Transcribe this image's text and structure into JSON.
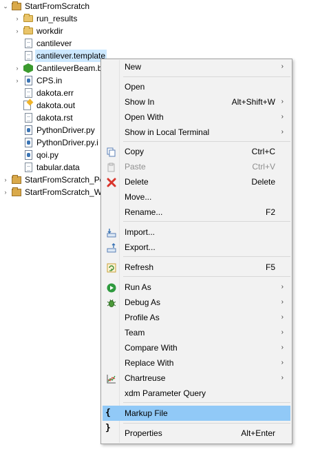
{
  "tree": {
    "items": [
      {
        "label": "StartFromScratch",
        "arrow": "⌄",
        "icon": "project-folder-icon"
      },
      {
        "label": "run_results",
        "arrow": "›",
        "icon": "folder-icon"
      },
      {
        "label": "workdir",
        "arrow": "›",
        "icon": "folder-icon"
      },
      {
        "label": "cantilever",
        "arrow": "",
        "icon": "file-icon"
      },
      {
        "label": "cantilever.template",
        "arrow": "",
        "icon": "file-icon"
      },
      {
        "label": "CantileverBeam.b",
        "arrow": "›",
        "icon": "hex-icon"
      },
      {
        "label": "CPS.in",
        "arrow": "›",
        "icon": "python-file-icon"
      },
      {
        "label": "dakota.err",
        "arrow": "",
        "icon": "file-icon"
      },
      {
        "label": "dakota.out",
        "arrow": "",
        "icon": "output-file-icon"
      },
      {
        "label": "dakota.rst",
        "arrow": "",
        "icon": "file-icon"
      },
      {
        "label": "PythonDriver.py",
        "arrow": "",
        "icon": "python-file-icon"
      },
      {
        "label": "PythonDriver.py.i",
        "arrow": "",
        "icon": "python-file-icon"
      },
      {
        "label": "qoi.py",
        "arrow": "",
        "icon": "python-file-icon"
      },
      {
        "label": "tabular.data",
        "arrow": "",
        "icon": "file-icon"
      },
      {
        "label": "StartFromScratch_Po",
        "arrow": "›",
        "icon": "project-folder-icon"
      },
      {
        "label": "StartFromScratch_W",
        "arrow": "›",
        "icon": "project-folder-icon"
      }
    ]
  },
  "menu": {
    "items": [
      {
        "label": "New",
        "accel": "",
        "submenu": true
      },
      {
        "label": "Open",
        "accel": "",
        "submenu": false
      },
      {
        "label": "Show In",
        "accel": "Alt+Shift+W",
        "submenu": true
      },
      {
        "label": "Open With",
        "accel": "",
        "submenu": true
      },
      {
        "label": "Show in Local Terminal",
        "accel": "",
        "submenu": true
      },
      {
        "label": "Copy",
        "accel": "Ctrl+C",
        "submenu": false
      },
      {
        "label": "Paste",
        "accel": "Ctrl+V",
        "submenu": false,
        "disabled": true
      },
      {
        "label": "Delete",
        "accel": "Delete",
        "submenu": false
      },
      {
        "label": "Move...",
        "accel": "",
        "submenu": false
      },
      {
        "label": "Rename...",
        "accel": "F2",
        "submenu": false
      },
      {
        "label": "Import...",
        "accel": "",
        "submenu": false
      },
      {
        "label": "Export...",
        "accel": "",
        "submenu": false
      },
      {
        "label": "Refresh",
        "accel": "F5",
        "submenu": false
      },
      {
        "label": "Run As",
        "accel": "",
        "submenu": true
      },
      {
        "label": "Debug As",
        "accel": "",
        "submenu": true
      },
      {
        "label": "Profile As",
        "accel": "",
        "submenu": true
      },
      {
        "label": "Team",
        "accel": "",
        "submenu": true
      },
      {
        "label": "Compare With",
        "accel": "",
        "submenu": true
      },
      {
        "label": "Replace With",
        "accel": "",
        "submenu": true
      },
      {
        "label": "Chartreuse",
        "accel": "",
        "submenu": true
      },
      {
        "label": "xdm Parameter Query",
        "accel": "",
        "submenu": false
      },
      {
        "label": "Markup File",
        "accel": "",
        "submenu": false,
        "highlighted": true
      },
      {
        "label": "Properties",
        "accel": "Alt+Enter",
        "submenu": false
      }
    ],
    "submenu_arrow": "›",
    "markup_icon_glyph": "{ }"
  },
  "colors": {
    "highlight": "#91c9f7",
    "selection": "#cce8ff",
    "run_green": "#2e9a3e",
    "delete_red": "#d9342b"
  }
}
